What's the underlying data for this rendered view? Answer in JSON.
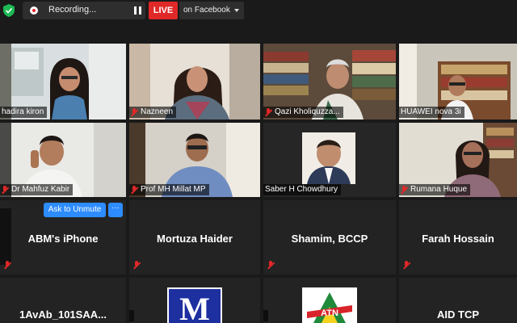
{
  "topbar": {
    "recording_label": "Recording...",
    "live_label": "LIVE",
    "stream_target": "on Facebook"
  },
  "participants": [
    {
      "name": "hadira kiron"
    },
    {
      "name": "Nazneen"
    },
    {
      "name": "Qazi Kholiquzza..."
    },
    {
      "name": "HUAWEI nova 3i"
    },
    {
      "name": "Dr Mahfuz Kabir"
    },
    {
      "name": "Prof MH Millat MP"
    },
    {
      "name": "Saber H Chowdhury"
    },
    {
      "name": "Rumana Huque"
    },
    {
      "name": "ABM's iPhone"
    },
    {
      "name": "Mortuza Haider"
    },
    {
      "name": "Shamim, BCCP"
    },
    {
      "name": "Farah Hossain"
    },
    {
      "name": "1AvAb_101SAA..."
    },
    {
      "name": ""
    },
    {
      "name": ""
    },
    {
      "name": "AID TCP"
    }
  ],
  "tile_actions": {
    "unmute_label": "Ask to Unmute",
    "more_label": "···"
  },
  "logos": {
    "m_letter": "M",
    "atn_letters": "ATN"
  },
  "colors": {
    "live_red": "#e02828",
    "active_speaker": "#c6e36b",
    "unmute_blue": "#2d8cff",
    "secure_green": "#1db954"
  },
  "icons": [
    "shield-check-icon",
    "record-icon",
    "pause-icon",
    "stop-icon",
    "chevron-down-icon",
    "mic-muted-icon"
  ]
}
